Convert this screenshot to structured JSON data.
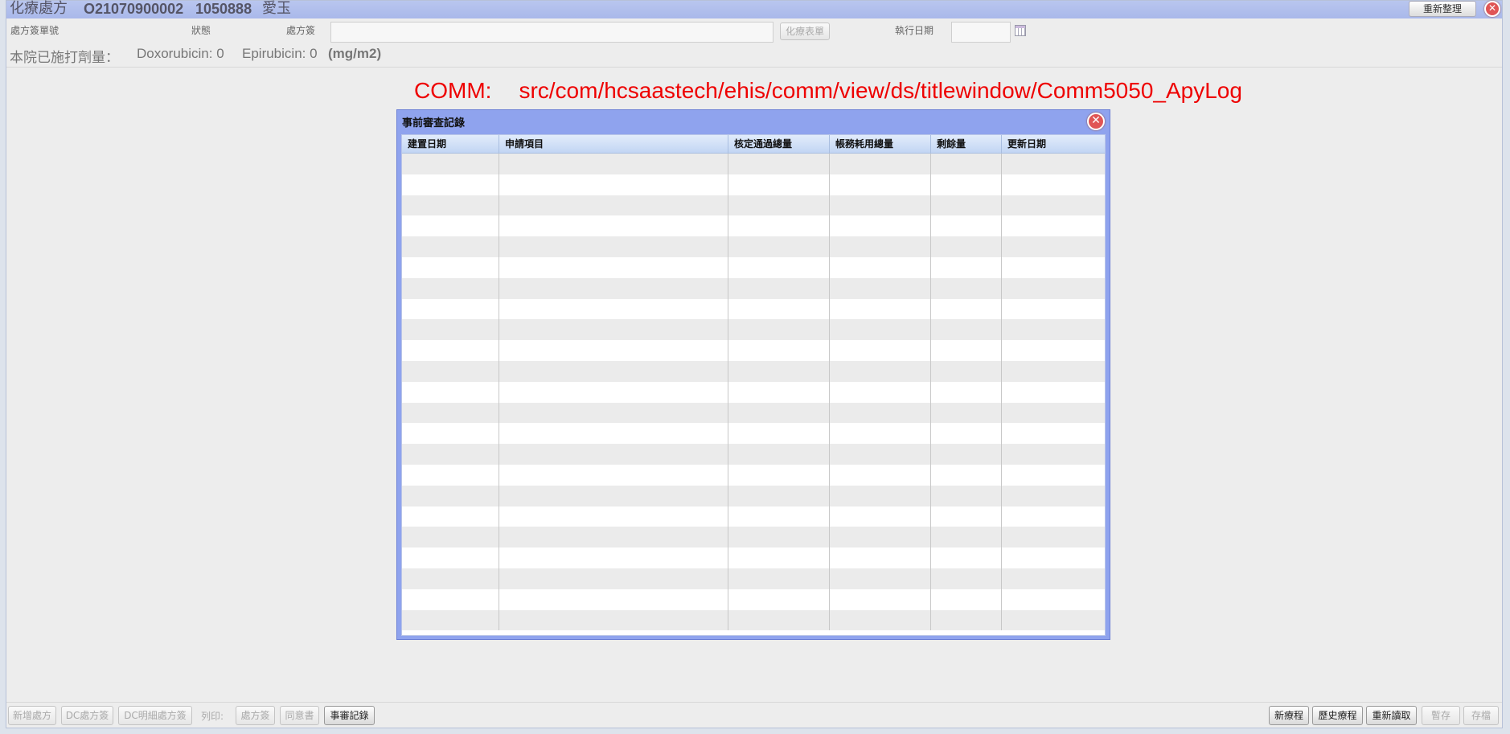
{
  "window": {
    "title": "化療處方",
    "order_id": "O21070900002",
    "chart_no": "1050888",
    "patient_name": "愛玉",
    "refresh_label": "重新整理",
    "close_glyph": "✕"
  },
  "form": {
    "order_no_label": "處方簽單號",
    "status_label": "狀態",
    "prescription_label": "處方簽",
    "chemo_form_label": "化療表單",
    "exec_date_label": "執行日期",
    "exec_date_value": ""
  },
  "dose": {
    "label": "本院已施打劑量：",
    "doxorubicin": "Doxorubicin: 0",
    "epirubicin": "Epirubicin: 0",
    "unit": "(mg/m2)"
  },
  "comm": {
    "prefix": "COMM:",
    "path": "src/com/hcsaastech/ehis/comm/view/ds/titlewindow/Comm5050_ApyLog"
  },
  "dialog": {
    "title": "事前審查記錄",
    "close_glyph": "✕",
    "columns": [
      "建置日期",
      "申請項目",
      "核定通過總量",
      "帳務耗用總量",
      "剩餘量",
      "更新日期"
    ],
    "rows": []
  },
  "bottom": {
    "left_buttons": [
      {
        "label": "新增處方",
        "enabled": false
      },
      {
        "label": "DC處方簽",
        "enabled": false
      },
      {
        "label": "DC明細處方簽",
        "enabled": false
      }
    ],
    "print_label": "列印:",
    "print_buttons": [
      {
        "label": "處方簽",
        "enabled": false
      },
      {
        "label": "同意書",
        "enabled": false
      },
      {
        "label": "事審記錄",
        "enabled": true
      }
    ],
    "right_buttons": [
      {
        "label": "新療程",
        "enabled": true
      },
      {
        "label": "歷史療程",
        "enabled": true
      },
      {
        "label": "重新讀取",
        "enabled": true
      },
      {
        "label": "暫存",
        "enabled": false
      },
      {
        "label": "存檔",
        "enabled": false
      }
    ]
  }
}
